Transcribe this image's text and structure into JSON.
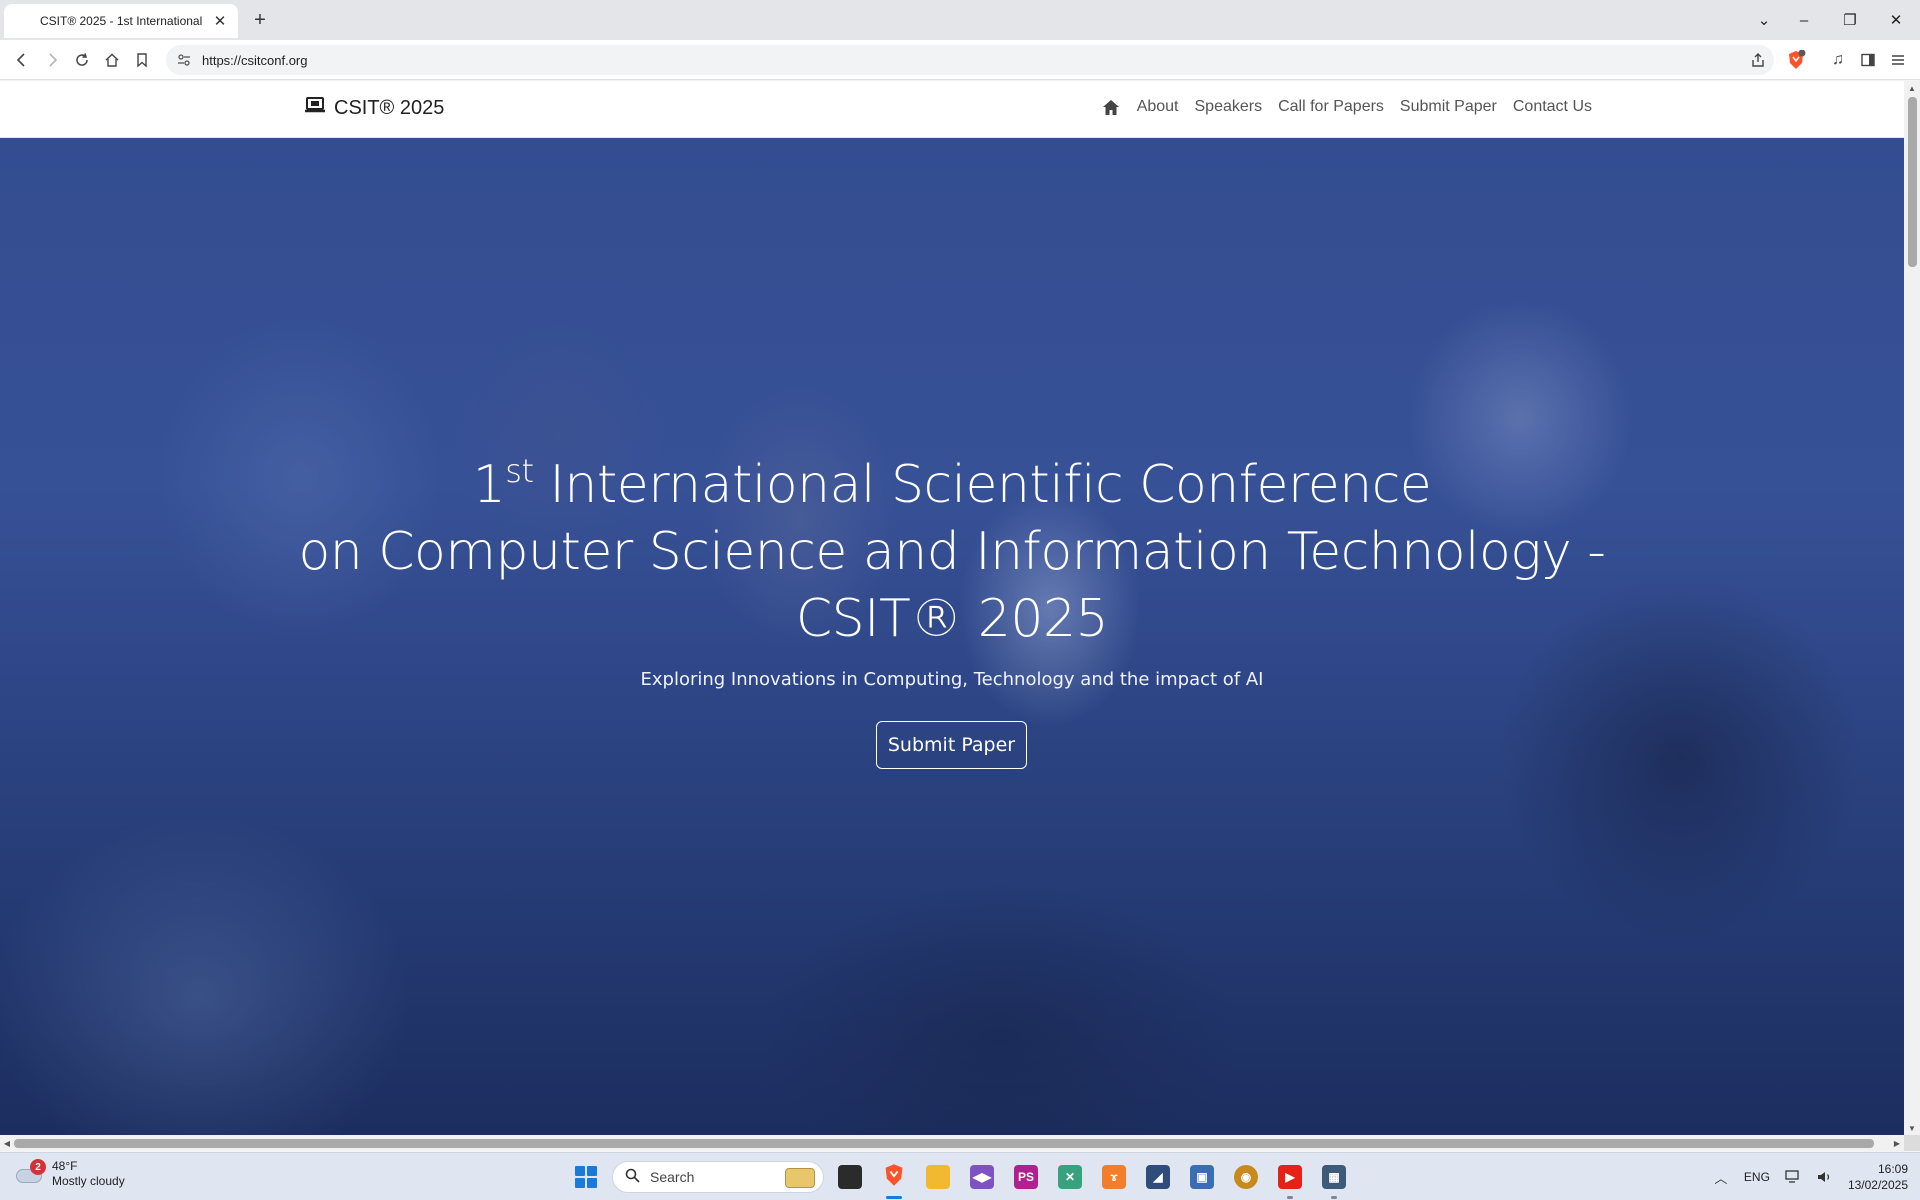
{
  "browser": {
    "tab_title": "CSIT® 2025 - 1st International",
    "url": "https://csitconf.org"
  },
  "site": {
    "brand": "CSIT® 2025",
    "nav": [
      "About",
      "Speakers",
      "Call for Papers",
      "Submit Paper",
      "Contact Us"
    ]
  },
  "hero": {
    "title_ordinal_num": "1",
    "title_ordinal_sup": "st",
    "title_line1_rest": " International Scientific Conference",
    "title_line2": "on Computer Science and Information Technology -",
    "title_line3": "CSIT® 2025",
    "subtitle": "Exploring Innovations in Computing, Technology and the impact of AI",
    "button": "Submit Paper"
  },
  "taskbar": {
    "weather_badge": "2",
    "weather_temp": "48°F",
    "weather_desc": "Mostly cloudy",
    "search_label": "Search",
    "lang": "ENG",
    "time": "16:09",
    "date": "13/02/2025"
  },
  "colors": {
    "hero_tint": "#3b57a0",
    "start_blue": "#1a7ad9",
    "brave_orange": "#fb542b"
  }
}
